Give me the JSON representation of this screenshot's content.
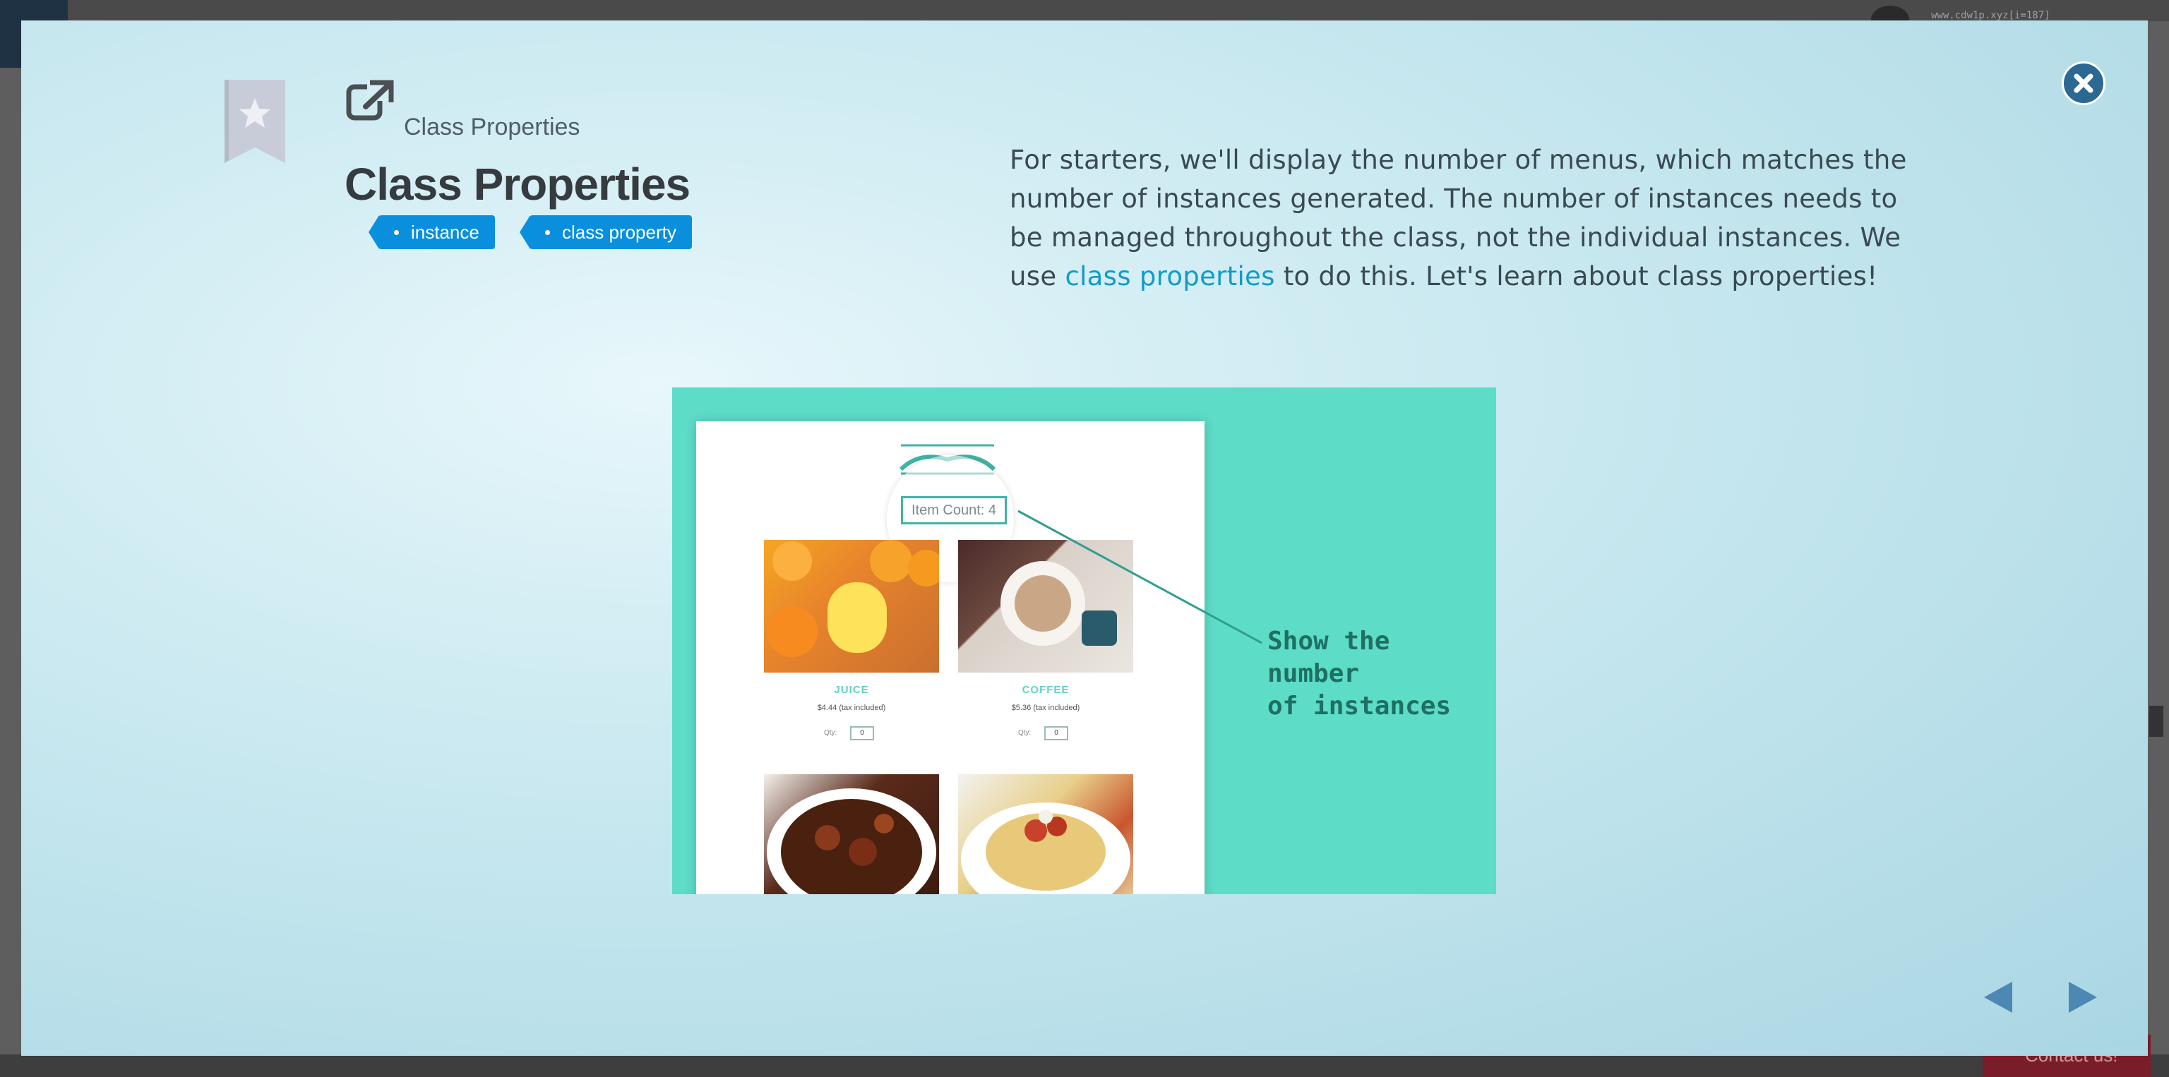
{
  "background": {
    "url_fragment": "www.cdw1p.xyz[i=187]",
    "contact_label": "Contact us!"
  },
  "modal": {
    "breadcrumb": "Class Properties",
    "title": "Class Properties",
    "tags": [
      {
        "label": "instance"
      },
      {
        "label": "class property"
      }
    ],
    "description": {
      "part1": "For starters, we'll display the number of menus, which matches the number of instances generated. The number of instances needs to be managed throughout the class, not the individual instances. We use ",
      "link": "class properties",
      "part2": " to do this. Let's learn about class properties!"
    },
    "figure": {
      "item_count": "Item Count: 4",
      "annotation_line1": "Show the number",
      "annotation_line2": "of instances",
      "items": [
        {
          "name": "JUICE",
          "price": "$4.44 (tax included)",
          "qty_label": "Qty:",
          "qty": "0"
        },
        {
          "name": "COFFEE",
          "price": "$5.36 (tax included)",
          "qty_label": "Qty:",
          "qty": "0"
        }
      ]
    }
  },
  "colors": {
    "accent": "#0a8fdc",
    "link": "#139bc8",
    "figure_bg": "#5ddcc8",
    "close": "#2b6892",
    "nav": "#4c88b3"
  },
  "icons": {
    "bookmark": "bookmark-star-icon",
    "external": "external-link-icon",
    "close": "close-icon",
    "prev": "triangle-left-icon",
    "next": "triangle-right-icon"
  }
}
